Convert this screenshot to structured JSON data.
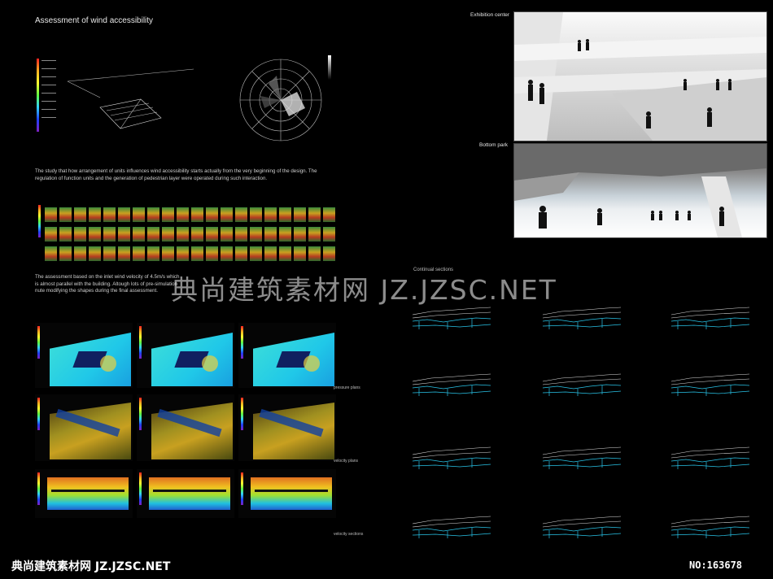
{
  "title": "Assessment of wind accessibility",
  "paragraph1": "The study that how arrangement of units influences wind accessibility starts actually from the very beginning of the design. The regulation of function units and the generation of pedestrian layer were operated during such interaction.",
  "paragraph2": "The assessment based on the inlet wind velocity of 4.5m/s which ... the building. Altough lots of pre-simulation ... nute modifying the shapes during the final assessment.",
  "paragraph2_lines": [
    "The assessment based on the inlet wind velocity of 4.5m/s which",
    "is almost parallel with the building. Altough lots of pre-simulation",
    "nute modifying the shapes during the final assessment."
  ],
  "plot_labels": {
    "pressure": "pressure plans",
    "velocity": "velocity plans",
    "velocity_sections": "velocity sections"
  },
  "right_labels": {
    "exhibition": "Exhibition center",
    "bottom_park": "Bottom park",
    "continual_sections": "Continual sections"
  },
  "watermark": "典尚建筑素材网 JZ.JZSC.NET",
  "footer_left": "典尚建筑素材网 JZ.JZSC.NET",
  "footer_right": "NO:163678",
  "colors": {
    "background": "#000000",
    "accent": "#29c4e8"
  }
}
